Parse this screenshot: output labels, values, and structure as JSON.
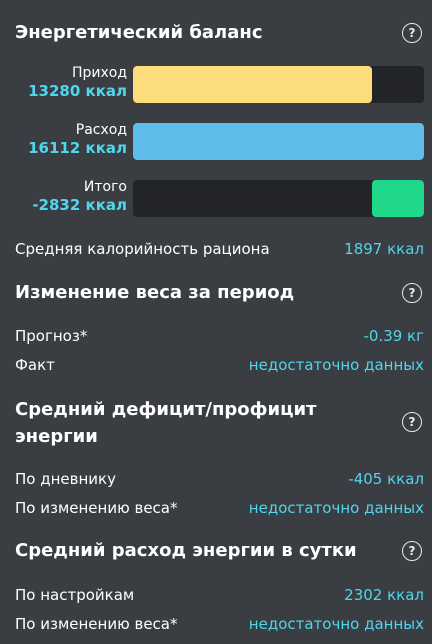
{
  "energy_balance": {
    "title": "Энергетический баланс",
    "help": "?",
    "bars": [
      {
        "name": "Приход",
        "value": "13280 ккал",
        "fill_fraction": 0.82,
        "align": "left",
        "color": "#fddc7b"
      },
      {
        "name": "Расход",
        "value": "16112 ккал",
        "fill_fraction": 1.0,
        "align": "left",
        "color": "#5fbde9"
      },
      {
        "name": "Итого",
        "value": "-2832 ккал",
        "fill_fraction": 0.18,
        "align": "right",
        "color": "#1fd88a"
      }
    ],
    "avg_calorie_label": "Средняя калорийность рациона",
    "avg_calorie_value": "1897 ккал"
  },
  "weight_change": {
    "title": "Изменение веса за период",
    "help": "?",
    "forecast_label": "Прогноз*",
    "forecast_value": "-0.39 кг",
    "fact_label": "Факт",
    "fact_value": "недостаточно данных"
  },
  "avg_deficit": {
    "title_line1": "Средний дефицит/профицит",
    "title_line2": "энергии",
    "help": "?",
    "diary_label": "По дневнику",
    "diary_value": "-405 ккал",
    "weight_label": "По изменению веса*",
    "weight_value": "недостаточно данных"
  },
  "avg_expense": {
    "title": "Средний расход энергии в сутки",
    "help": "?",
    "settings_label": "По настройкам",
    "settings_value": "2302 ккал",
    "weight_label": "По изменению веса*",
    "weight_value": "недостаточно данных"
  }
}
